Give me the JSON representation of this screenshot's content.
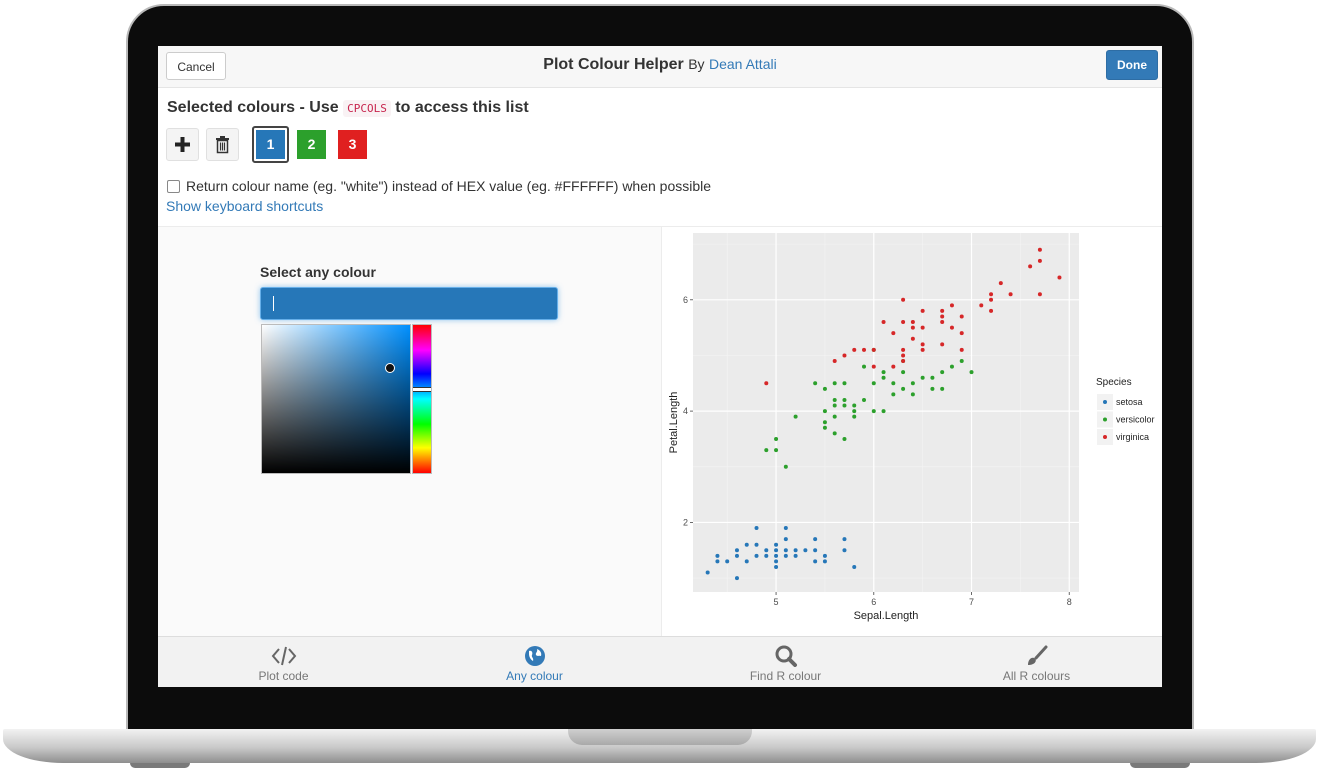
{
  "header": {
    "cancel_label": "Cancel",
    "title": "Plot Colour Helper",
    "by": "By",
    "author": "Dean Attali",
    "done_label": "Done"
  },
  "selected": {
    "heading_pre": "Selected colours - Use",
    "code": "CPCOLS",
    "heading_post": "to access this list",
    "add_icon": "plus-icon",
    "delete_icon": "trash-icon",
    "swatches": [
      {
        "label": "1",
        "color": "#2677b8"
      },
      {
        "label": "2",
        "color": "#2ca02c"
      },
      {
        "label": "3",
        "color": "#e02020"
      }
    ],
    "return_name_label": "Return colour name (eg. \"white\") instead of HEX value (eg. #FFFFFF) when possible",
    "shortcuts_link": "Show keyboard shortcuts"
  },
  "picker": {
    "label": "Select any colour",
    "current_color": "#2677b8"
  },
  "nav": [
    {
      "label": "Plot code",
      "icon": "code-icon"
    },
    {
      "label": "Any colour",
      "icon": "globe-icon",
      "active": true
    },
    {
      "label": "Find R colour",
      "icon": "search-icon"
    },
    {
      "label": "All R colours",
      "icon": "paintbrush-icon"
    }
  ],
  "chart_data": {
    "type": "scatter",
    "xlabel": "Sepal.Length",
    "ylabel": "Petal.Length",
    "xlim": [
      4.15,
      8.1
    ],
    "ylim": [
      0.75,
      7.2
    ],
    "xticks": [
      "5",
      "6",
      "7",
      "8"
    ],
    "yticks": [
      "2",
      "4",
      "6"
    ],
    "grid": true,
    "legend_title": "Species",
    "legend_position": "right",
    "series": [
      {
        "name": "setosa",
        "color": "#2677b8",
        "points": [
          [
            4.3,
            1.1
          ],
          [
            4.4,
            1.3
          ],
          [
            4.4,
            1.4
          ],
          [
            4.5,
            1.3
          ],
          [
            4.6,
            1.0
          ],
          [
            4.6,
            1.4
          ],
          [
            4.6,
            1.5
          ],
          [
            4.7,
            1.3
          ],
          [
            4.7,
            1.6
          ],
          [
            4.8,
            1.4
          ],
          [
            4.8,
            1.6
          ],
          [
            4.8,
            1.9
          ],
          [
            4.9,
            1.4
          ],
          [
            4.9,
            1.5
          ],
          [
            5.0,
            1.2
          ],
          [
            5.0,
            1.3
          ],
          [
            5.0,
            1.4
          ],
          [
            5.0,
            1.5
          ],
          [
            5.0,
            1.6
          ],
          [
            5.1,
            1.4
          ],
          [
            5.1,
            1.5
          ],
          [
            5.1,
            1.7
          ],
          [
            5.1,
            1.9
          ],
          [
            5.2,
            1.4
          ],
          [
            5.2,
            1.5
          ],
          [
            5.3,
            1.5
          ],
          [
            5.4,
            1.3
          ],
          [
            5.4,
            1.5
          ],
          [
            5.4,
            1.7
          ],
          [
            5.5,
            1.3
          ],
          [
            5.5,
            1.4
          ],
          [
            5.7,
            1.5
          ],
          [
            5.7,
            1.7
          ],
          [
            5.8,
            1.2
          ]
        ]
      },
      {
        "name": "versicolor",
        "color": "#2ca02c",
        "points": [
          [
            4.9,
            3.3
          ],
          [
            5.0,
            3.3
          ],
          [
            5.0,
            3.5
          ],
          [
            5.1,
            3.0
          ],
          [
            5.2,
            3.9
          ],
          [
            5.4,
            4.5
          ],
          [
            5.5,
            3.7
          ],
          [
            5.5,
            3.8
          ],
          [
            5.5,
            4.0
          ],
          [
            5.5,
            4.4
          ],
          [
            5.6,
            3.6
          ],
          [
            5.6,
            3.9
          ],
          [
            5.6,
            4.1
          ],
          [
            5.6,
            4.2
          ],
          [
            5.6,
            4.5
          ],
          [
            5.7,
            3.5
          ],
          [
            5.7,
            4.1
          ],
          [
            5.7,
            4.2
          ],
          [
            5.7,
            4.5
          ],
          [
            5.8,
            3.9
          ],
          [
            5.8,
            4.0
          ],
          [
            5.8,
            4.1
          ],
          [
            5.9,
            4.2
          ],
          [
            5.9,
            4.8
          ],
          [
            6.0,
            4.0
          ],
          [
            6.0,
            4.5
          ],
          [
            6.0,
            5.1
          ],
          [
            6.1,
            4.0
          ],
          [
            6.1,
            4.6
          ],
          [
            6.1,
            4.7
          ],
          [
            6.2,
            4.3
          ],
          [
            6.2,
            4.5
          ],
          [
            6.3,
            4.4
          ],
          [
            6.3,
            4.7
          ],
          [
            6.3,
            4.9
          ],
          [
            6.4,
            4.3
          ],
          [
            6.4,
            4.5
          ],
          [
            6.5,
            4.6
          ],
          [
            6.6,
            4.4
          ],
          [
            6.6,
            4.6
          ],
          [
            6.7,
            4.4
          ],
          [
            6.7,
            4.7
          ],
          [
            6.8,
            4.8
          ],
          [
            6.9,
            4.9
          ],
          [
            7.0,
            4.7
          ]
        ]
      },
      {
        "name": "virginica",
        "color": "#d62728",
        "points": [
          [
            4.9,
            4.5
          ],
          [
            5.6,
            4.9
          ],
          [
            5.7,
            5.0
          ],
          [
            5.8,
            5.1
          ],
          [
            5.9,
            5.1
          ],
          [
            6.0,
            4.8
          ],
          [
            6.0,
            5.1
          ],
          [
            6.1,
            5.6
          ],
          [
            6.2,
            4.8
          ],
          [
            6.2,
            5.4
          ],
          [
            6.3,
            4.9
          ],
          [
            6.3,
            5.0
          ],
          [
            6.3,
            5.1
          ],
          [
            6.3,
            5.6
          ],
          [
            6.3,
            6.0
          ],
          [
            6.4,
            5.3
          ],
          [
            6.4,
            5.5
          ],
          [
            6.4,
            5.6
          ],
          [
            6.5,
            5.1
          ],
          [
            6.5,
            5.2
          ],
          [
            6.5,
            5.5
          ],
          [
            6.5,
            5.8
          ],
          [
            6.7,
            5.2
          ],
          [
            6.7,
            5.6
          ],
          [
            6.7,
            5.7
          ],
          [
            6.7,
            5.8
          ],
          [
            6.8,
            5.5
          ],
          [
            6.8,
            5.9
          ],
          [
            6.9,
            5.1
          ],
          [
            6.9,
            5.4
          ],
          [
            6.9,
            5.7
          ],
          [
            7.1,
            5.9
          ],
          [
            7.2,
            5.8
          ],
          [
            7.2,
            6.0
          ],
          [
            7.2,
            6.1
          ],
          [
            7.3,
            6.3
          ],
          [
            7.4,
            6.1
          ],
          [
            7.6,
            6.6
          ],
          [
            7.7,
            6.1
          ],
          [
            7.7,
            6.7
          ],
          [
            7.7,
            6.9
          ],
          [
            7.9,
            6.4
          ]
        ]
      }
    ]
  }
}
